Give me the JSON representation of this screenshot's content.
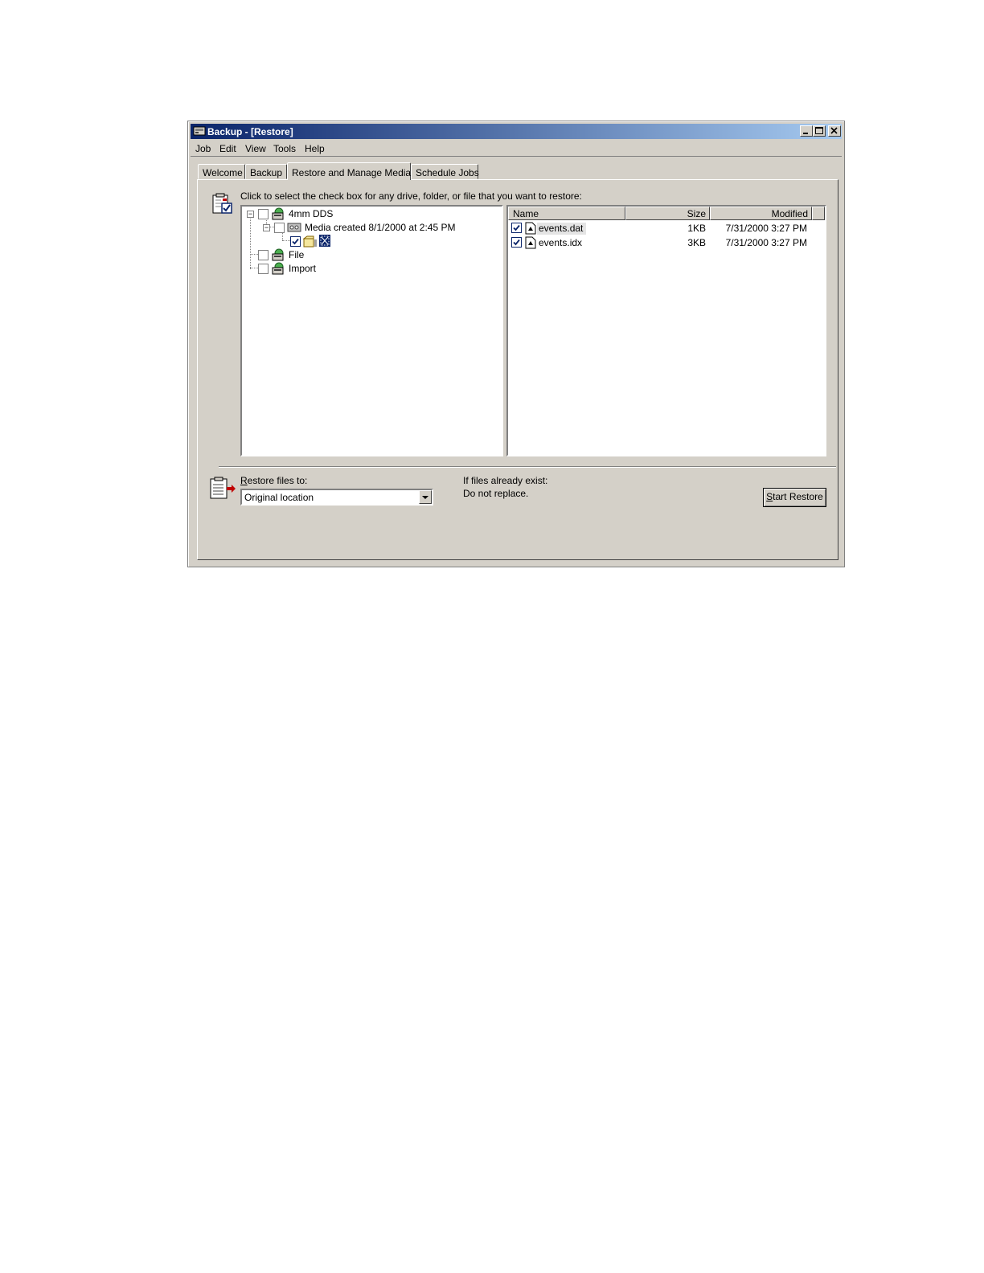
{
  "window": {
    "title": "Backup - [Restore]"
  },
  "menu": [
    "Job",
    "Edit",
    "View",
    "Tools",
    "Help"
  ],
  "tabs": [
    "Welcome",
    "Backup",
    "Restore and Manage Media",
    "Schedule Jobs"
  ],
  "active_tab": "Restore and Manage Media",
  "instruction": "Click to select the check box for any drive, folder, or file that you want to restore:",
  "tree": {
    "drive": "4mm DDS",
    "media": "Media created 8/1/2000 at 2:45 PM",
    "file": "File",
    "import": "Import"
  },
  "list": {
    "columns": [
      "Name",
      "Size",
      "Modified"
    ],
    "rows": [
      {
        "name": "events.dat",
        "size": "1KB",
        "modified": "7/31/2000 3:27 PM",
        "checked": true
      },
      {
        "name": "events.idx",
        "size": "3KB",
        "modified": "7/31/2000 3:27 PM",
        "checked": true
      }
    ]
  },
  "restore": {
    "label_first": "R",
    "label_rest": "estore files to:",
    "value": "Original location"
  },
  "existing": {
    "label": "If files already exist:",
    "value": "Do not replace."
  },
  "start_button": {
    "first": "S",
    "rest": "tart Restore"
  },
  "colors": {
    "titlebar_start": "#0a246a",
    "titlebar_end": "#a6caf0",
    "face": "#d4d0c8"
  }
}
